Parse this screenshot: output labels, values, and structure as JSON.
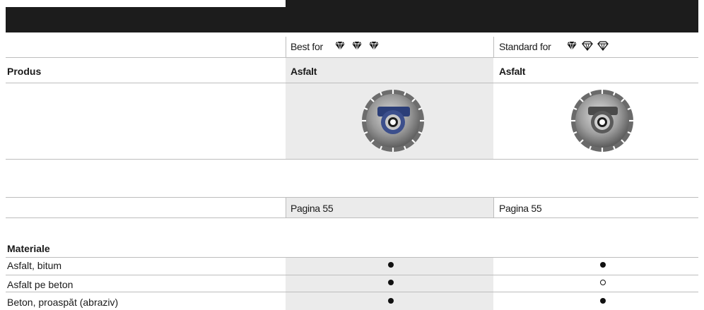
{
  "header": {
    "col1_grade": "Best for",
    "col2_grade": "Standard for",
    "col1_gem_icons": [
      "diamond-filled-icon",
      "diamond-filled-icon",
      "diamond-filled-icon"
    ],
    "col2_gem_icons": [
      "diamond-filled-icon",
      "diamond-outline-icon",
      "diamond-outline-icon"
    ]
  },
  "product_row": {
    "label": "Produs",
    "col1": "Asfalt",
    "col2": "Asfalt"
  },
  "images": {
    "col1": "diamond-cutting-disc-image",
    "col2": "diamond-cutting-disc-image"
  },
  "page_row": {
    "col1": "Pagina 55",
    "col2": "Pagina 55"
  },
  "materials": {
    "title": "Materiale",
    "rows": [
      {
        "label": "Asfalt, bitum",
        "col1": "filled",
        "col2": "filled"
      },
      {
        "label": "Asfalt pe beton",
        "col1": "filled",
        "col2": "empty"
      },
      {
        "label": "Beton, proaspăt (abraziv)",
        "col1": "filled",
        "col2": "filled"
      }
    ]
  },
  "colors": {
    "header_bar": "#1c1c1c",
    "shaded_column": "#ebebeb",
    "rule": "#bdbdbd",
    "dot": "#111111"
  }
}
